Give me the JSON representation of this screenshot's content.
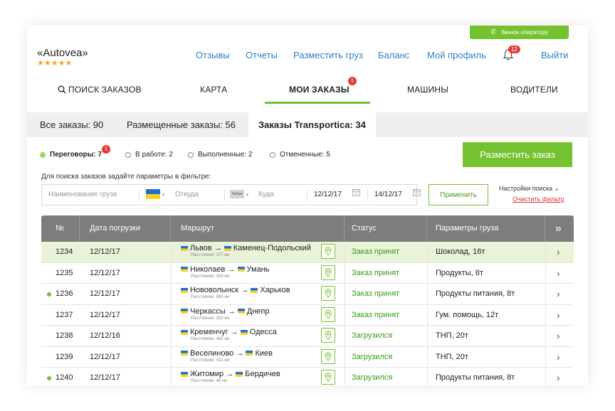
{
  "header": {
    "call_button": "Звонок оператору",
    "logo": "«Autovea»",
    "stars": "★★★★★",
    "nav": [
      "Отзывы",
      "Отчеты",
      "Разместить груз",
      "Баланс",
      "Мой профиль"
    ],
    "notifications_count": "12",
    "logout": "Выйти"
  },
  "main_tabs": [
    {
      "label": "ПОИСК ЗАКАЗОВ"
    },
    {
      "label": "КАРТА"
    },
    {
      "label": "МОИ ЗАКАЗЫ",
      "badge": "1"
    },
    {
      "label": "МАШИНЫ"
    },
    {
      "label": "ВОДИТЕЛИ"
    }
  ],
  "sub_tabs": [
    "Все заказы: 90",
    "Размещенные заказы: 56",
    "Заказы Transportica: 34"
  ],
  "status_filters": [
    {
      "label": "Переговоры: 7",
      "badge": "1",
      "selected": true
    },
    {
      "label": "В работе: 2"
    },
    {
      "label": "Выполненные: 2"
    },
    {
      "label": "Отмененные: 5"
    }
  ],
  "place_order_button": "Разместить заказ",
  "filter": {
    "hint": "Для поиска заказов задайте параметры в фильтре:",
    "cargo_placeholder": "Наименование груза",
    "from_placeholder": "Откуда",
    "to_flag_label": "Любая",
    "to_placeholder": "Куда",
    "date_from": "12/12/17",
    "date_to": "14/12/17",
    "apply": "Применить",
    "settings": "Настройки поиска",
    "clear": "Очистить фильтр"
  },
  "table": {
    "columns": [
      "№",
      "Дата погрузки",
      "Маршрут",
      "Статус",
      "Параметры груза",
      "»"
    ],
    "rows": [
      {
        "no": "1234",
        "date": "12/12/17",
        "from": "Львов",
        "to": "Каменец-Подольский",
        "dist": "Расстояние: 277 км",
        "status": "Заказ принят",
        "cargo": "Шоколад, 16т",
        "highlight": true,
        "dot": false
      },
      {
        "no": "1235",
        "date": "12/12/17",
        "from": "Николаев",
        "to": "Умань",
        "dist": "Расстояние: 283 км",
        "status": "Заказ принят",
        "cargo": "Продукты, 8т",
        "highlight": false,
        "dot": false
      },
      {
        "no": "1236",
        "date": "12/12/17",
        "from": "Нововолынск",
        "to": "Харьков",
        "dist": "Расстояние: 965 км",
        "status": "Заказ принят",
        "cargo": "Продукты питания, 8т",
        "highlight": false,
        "dot": true
      },
      {
        "no": "1237",
        "date": "12/12/17",
        "from": "Черкассы",
        "to": "Днепр",
        "dist": "Расстояние: 283 км",
        "status": "Заказ принят",
        "cargo": "Гум. помощь, 12т",
        "highlight": false,
        "dot": false
      },
      {
        "no": "1238",
        "date": "12/12/16",
        "from": "Кременчуг",
        "to": "Одесса",
        "dist": "Расстояние: 462 км",
        "status": "Загрузился",
        "cargo": "ТНП, 20т",
        "highlight": false,
        "dot": false
      },
      {
        "no": "1239",
        "date": "12/12/17",
        "from": "Веселиново",
        "to": "Киев",
        "dist": "Расстояние: 421 км",
        "status": "Загрузился",
        "cargo": "ТНП, 20т",
        "highlight": false,
        "dot": false
      },
      {
        "no": "1240",
        "date": "12/12/17",
        "from": "Житомир",
        "to": "Бердичев",
        "dist": "Расстояние: 46 км",
        "status": "Загрузился",
        "cargo": "Продукты питания, 8т",
        "highlight": false,
        "dot": true
      }
    ]
  },
  "colors": {
    "accent": "#75c230",
    "link": "#2f7fc6",
    "badge": "#e63c3c",
    "header_gray": "#7d7d7d"
  }
}
